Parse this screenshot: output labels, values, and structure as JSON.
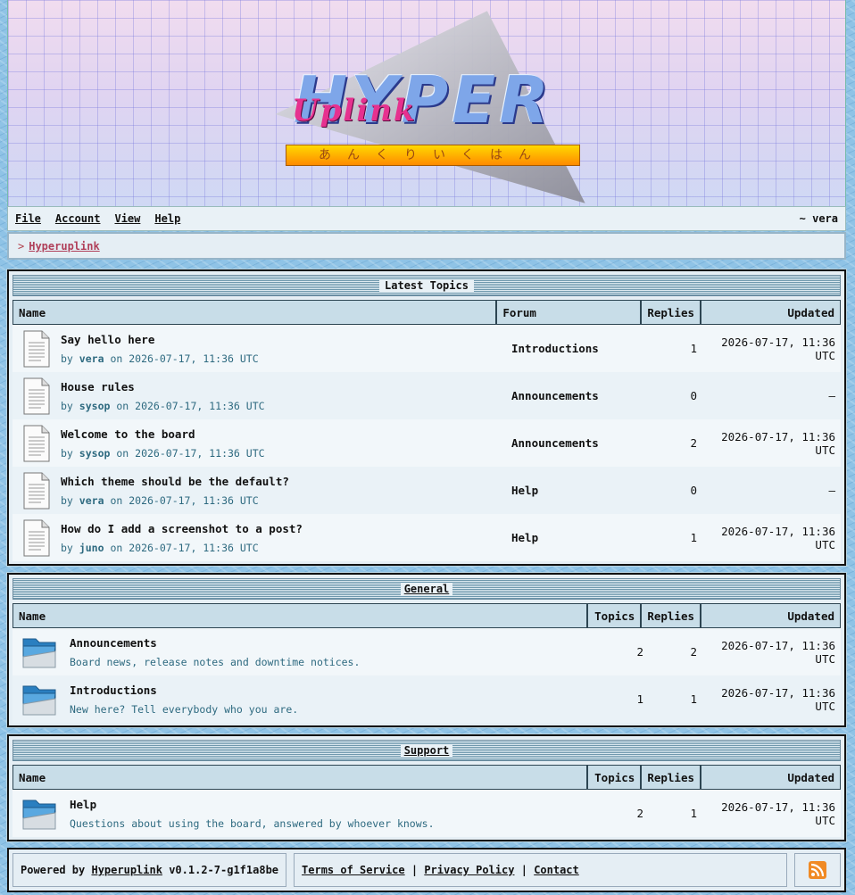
{
  "menu": {
    "file": "File",
    "account": "Account",
    "view": "View",
    "help": "Help",
    "user": "~ vera"
  },
  "breadcrumb": {
    "chevron": ">",
    "link": "Hyperuplink"
  },
  "latest": {
    "title": "Latest Topics",
    "headers": {
      "name": "Name",
      "forum": "Forum",
      "replies": "Replies",
      "updated": "Updated"
    },
    "rows": [
      {
        "title": "Say hello here",
        "by": "by",
        "author": "vera",
        "on": "on",
        "date": "2026-07-17, 11:36 UTC",
        "forum": "Introductions",
        "replies": "1",
        "updated": "2026-07-17, 11:36 UTC"
      },
      {
        "title": "House rules",
        "by": "by",
        "author": "sysop",
        "on": "on",
        "date": "2026-07-17, 11:36 UTC",
        "forum": "Announcements",
        "replies": "0",
        "updated": "–"
      },
      {
        "title": "Welcome to the board",
        "by": "by",
        "author": "sysop",
        "on": "on",
        "date": "2026-07-17, 11:36 UTC",
        "forum": "Announcements",
        "replies": "2",
        "updated": "2026-07-17, 11:36 UTC"
      },
      {
        "title": "Which theme should be the default?",
        "by": "by",
        "author": "vera",
        "on": "on",
        "date": "2026-07-17, 11:36 UTC",
        "forum": "Help",
        "replies": "0",
        "updated": "–"
      },
      {
        "title": "How do I add a screenshot to a post?",
        "by": "by",
        "author": "juno",
        "on": "on",
        "date": "2026-07-17, 11:36 UTC",
        "forum": "Help",
        "replies": "1",
        "updated": "2026-07-17, 11:36 UTC"
      }
    ]
  },
  "general": {
    "title": "General",
    "headers": {
      "name": "Name",
      "topics": "Topics",
      "replies": "Replies",
      "updated": "Updated"
    },
    "rows": [
      {
        "title": "Announcements",
        "desc": "Board news, release notes and downtime notices.",
        "topics": "2",
        "replies": "2",
        "updated": "2026-07-17, 11:36 UTC"
      },
      {
        "title": "Introductions",
        "desc": "New here? Tell everybody who you are.",
        "topics": "1",
        "replies": "1",
        "updated": "2026-07-17, 11:36 UTC"
      }
    ]
  },
  "support": {
    "title": "Support",
    "headers": {
      "name": "Name",
      "topics": "Topics",
      "replies": "Replies",
      "updated": "Updated"
    },
    "rows": [
      {
        "title": "Help",
        "desc": "Questions about using the board, answered by whoever knows.",
        "topics": "2",
        "replies": "1",
        "updated": "2026-07-17, 11:36 UTC"
      }
    ]
  },
  "footer": {
    "powered": "Powered by",
    "product": "Hyperuplink",
    "version": "v0.1.2-7-g1f1a8be",
    "tos": "Terms of Service",
    "sep": "|",
    "privacy": "Privacy Policy",
    "contact": "Contact"
  },
  "colors": {
    "accent": "#b0405a",
    "rss": "#f08a24"
  }
}
